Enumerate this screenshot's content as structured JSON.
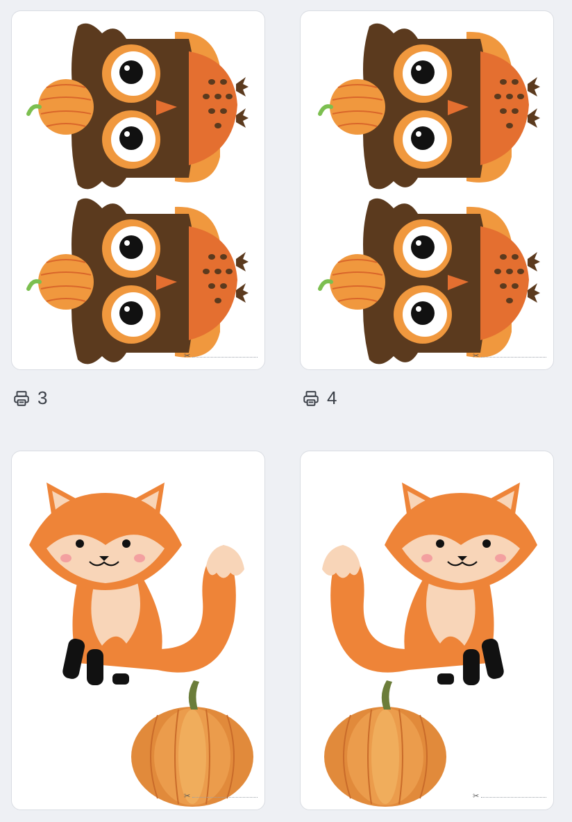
{
  "cards": [
    {
      "name": "owl-card-3",
      "print_count": "3",
      "subject": "owl-with-pumpkin"
    },
    {
      "name": "owl-card-4",
      "print_count": "4",
      "subject": "owl-with-pumpkin"
    },
    {
      "name": "fox-card-left",
      "subject": "fox-with-pumpkin"
    },
    {
      "name": "fox-card-right",
      "subject": "fox-with-pumpkin-mirrored"
    }
  ],
  "icons": {
    "print": "printer-icon",
    "cut": "scissors-icon"
  },
  "colors": {
    "background": "#eef0f4",
    "owl_brown": "#5b3a1e",
    "owl_orange": "#f0983e",
    "fox_orange": "#ee8438",
    "fox_cream": "#f8d5b8"
  }
}
